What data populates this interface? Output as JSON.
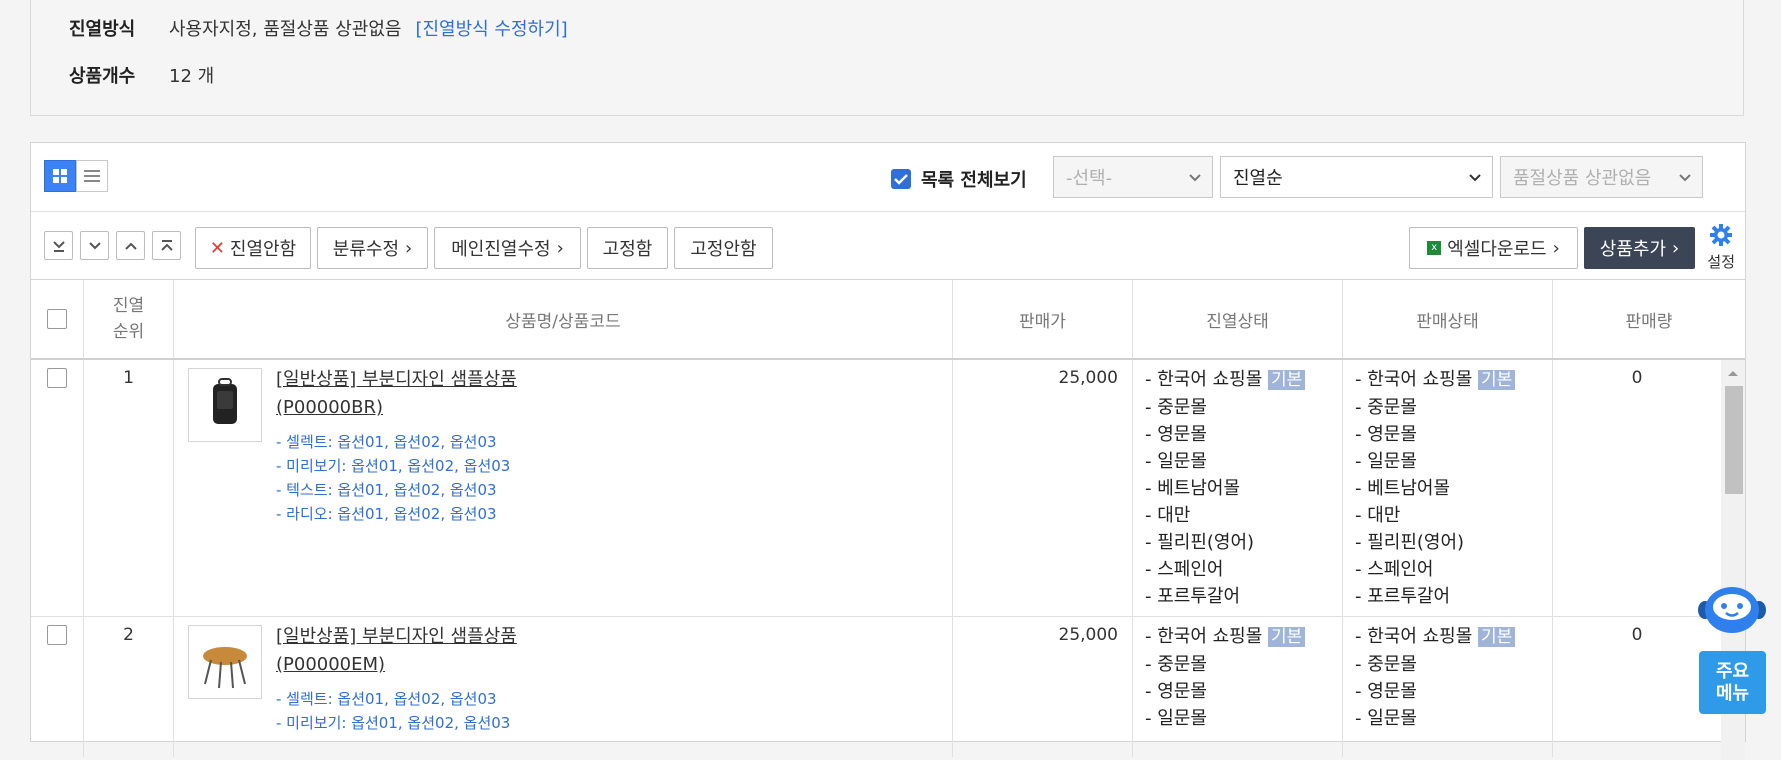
{
  "info": {
    "display_label": "진열방식",
    "display_value": "사용자지정, 품절상품 상관없음",
    "display_edit_link": "[진열방식 수정하기]",
    "count_label": "상품개수",
    "count_value": "12 개"
  },
  "toolbar": {
    "view_all_label": "목록 전체보기",
    "select_placeholder": "-선택-",
    "sort_value": "진열순",
    "soldout_value": "품절상품 상관없음",
    "actions": {
      "hide": "진열안함",
      "category_edit": "분류수정",
      "main_display_edit": "메인진열수정",
      "fix": "고정함",
      "unfix": "고정안함",
      "excel": "엑셀다운로드",
      "add_product": "상품추가",
      "settings": "설정"
    }
  },
  "table": {
    "headers": {
      "rank": "진열\n순위",
      "name": "상품명/상품코드",
      "price": "판매가",
      "display_status": "진열상태",
      "sale_status": "판매상태",
      "sales_qty": "판매량"
    },
    "default_tag": "기본",
    "rows": [
      {
        "rank": "1",
        "name": "[일반상품] 부분디자인 샘플상품",
        "code": "(P00000BR)",
        "options": [
          "- 셀렉트: 옵션01, 옵션02, 옵션03",
          "- 미리보기: 옵션01, 옵션02, 옵션03",
          "- 텍스트: 옵션01, 옵션02, 옵션03",
          "- 라디오: 옵션01, 옵션02, 옵션03"
        ],
        "price": "25,000",
        "malls": [
          "- 한국어 쇼핑몰",
          "- 중문몰",
          "- 영문몰",
          "- 일문몰",
          "- 베트남어몰",
          "- 대만",
          "- 필리핀(영어)",
          "- 스페인어",
          "- 포르투갈어"
        ],
        "sales_qty": "0"
      },
      {
        "rank": "2",
        "name": "[일반상품] 부분디자인 샘플상품",
        "code": "(P00000EM)",
        "options": [
          "- 셀렉트: 옵션01, 옵션02, 옵션03",
          "- 미리보기: 옵션01, 옵션02, 옵션03"
        ],
        "price": "25,000",
        "malls": [
          "- 한국어 쇼핑몰",
          "- 중문몰",
          "- 영문몰",
          "- 일문몰"
        ],
        "sales_qty": "0"
      }
    ]
  },
  "floating": {
    "main_menu": "주요\n메뉴"
  },
  "colors": {
    "accent": "#2f6fd6",
    "dark_button": "#3c4555",
    "tag": "#9fb4d8",
    "main_menu": "#2f9be8"
  }
}
